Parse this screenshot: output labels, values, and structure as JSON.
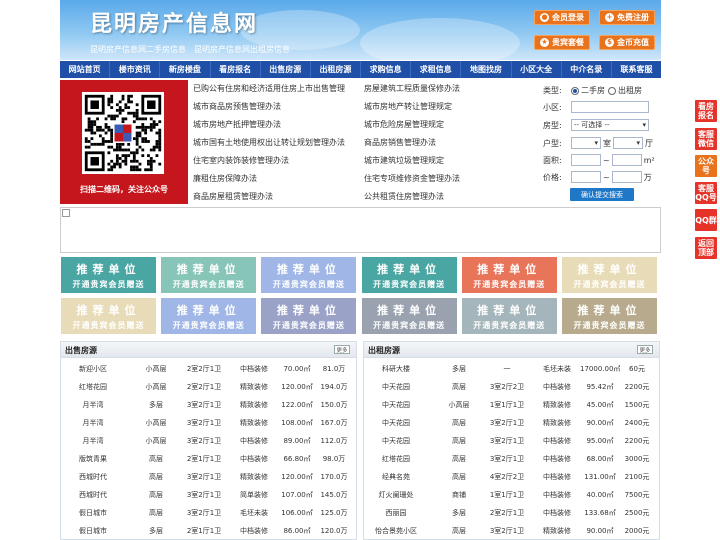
{
  "header": {
    "logo": "昆明房产信息网",
    "subtitle": "昆明房产信息网二手房信息　昆明房产信息网出租房信息",
    "buttons": [
      {
        "label": "会员登录",
        "icon": "user-icon"
      },
      {
        "label": "免费注册",
        "icon": "user-add-icon"
      },
      {
        "label": "贵宾套餐",
        "icon": "vip-icon"
      },
      {
        "label": "金币充值",
        "icon": "coin-icon"
      }
    ],
    "accent": "#e8731c"
  },
  "nav": [
    "网站首页",
    "楼市资讯",
    "新房楼盘",
    "看房报名",
    "出售房源",
    "出租房源",
    "求购信息",
    "求租信息",
    "地图找房",
    "小区大全",
    "中介名录",
    "联系客服"
  ],
  "qr": {
    "caption": "扫描二维码，关注公众号"
  },
  "links_left": [
    "已购公有住房和经济适用住房上市出售管理",
    "城市商品房预售管理办法",
    "城市房地产抵押管理办法",
    "城市国有土地使用权出让转让规划管理办法",
    "住宅室内装饰装修管理办法",
    "廉租住房保障办法",
    "商品房屋租赁管理办法"
  ],
  "links_right": [
    "房屋建筑工程质量保修办法",
    "城市房地产转让管理规定",
    "城市危险房屋管理规定",
    "商品房销售管理办法",
    "城市建筑垃圾管理规定",
    "住宅专项维修资金管理办法",
    "公共租赁住房管理办法"
  ],
  "search": {
    "type_label": "类型:",
    "opt_sale": "二手房",
    "opt_rent": "出租房",
    "community_label": "小区:",
    "housetype_label": "房型:",
    "housetype_value": "-- 可选择 --",
    "layout_label": "户型:",
    "room": "室",
    "hall": "厅",
    "area_label": "面积:",
    "area_unit": "m²",
    "price_label": "价格:",
    "price_unit": "万",
    "tilde": "~",
    "button": "确认提交搜索"
  },
  "recommend": {
    "title": "推荐单位",
    "sub": "开通贵宾会员赠送",
    "colors": [
      "#4aa6a3",
      "#87c5b8",
      "#9fb6e6",
      "#4aa6a3",
      "#e8745a",
      "#e8dcb8",
      "#e8dcb8",
      "#9fb6e6",
      "#9aa2c8",
      "#9aa2b0",
      "#a4b6bc",
      "#b8aa8c"
    ]
  },
  "sale": {
    "title": "出售房源",
    "more": "更多",
    "rows": [
      [
        "新迎小区",
        "小高层",
        "2室2厅1卫",
        "中档装修",
        "70.00㎡",
        "81.0万"
      ],
      [
        "红塔花园",
        "小高层",
        "2室2厅1卫",
        "精致装修",
        "120.00㎡",
        "194.0万"
      ],
      [
        "月半湾",
        "多层",
        "3室2厅1卫",
        "精致装修",
        "122.00㎡",
        "150.0万"
      ],
      [
        "月半湾",
        "小高层",
        "3室2厅1卫",
        "精致装修",
        "108.00㎡",
        "167.0万"
      ],
      [
        "月半湾",
        "小高层",
        "3室2厅1卫",
        "中档装修",
        "89.00㎡",
        "112.0万"
      ],
      [
        "版筑青果",
        "高层",
        "2室1厅1卫",
        "中档装修",
        "66.80㎡",
        "98.0万"
      ],
      [
        "西城时代",
        "高层",
        "3室2厅1卫",
        "精致装修",
        "120.00㎡",
        "170.0万"
      ],
      [
        "西城时代",
        "高层",
        "3室2厅1卫",
        "简单装修",
        "107.00㎡",
        "145.0万"
      ],
      [
        "假日城市",
        "高层",
        "3室2厅1卫",
        "毛坯未装",
        "106.00㎡",
        "125.0万"
      ],
      [
        "假日城市",
        "多层",
        "2室1厅1卫",
        "中档装修",
        "86.00㎡",
        "120.0万"
      ]
    ]
  },
  "rent": {
    "title": "出租房源",
    "more": "更多",
    "rows": [
      [
        "科研大楼",
        "多层",
        "一",
        "毛坯未装",
        "17000.00㎡",
        "60元"
      ],
      [
        "中天花园",
        "高层",
        "3室2厅2卫",
        "中档装修",
        "95.42㎡",
        "2200元"
      ],
      [
        "中天花园",
        "小高层",
        "1室1厅1卫",
        "精致装修",
        "45.00㎡",
        "1500元"
      ],
      [
        "中天花园",
        "高层",
        "3室2厅1卫",
        "精致装修",
        "90.00㎡",
        "2400元"
      ],
      [
        "中天花园",
        "高层",
        "3室2厅1卫",
        "中档装修",
        "95.00㎡",
        "2200元"
      ],
      [
        "红塔花园",
        "高层",
        "3室2厅1卫",
        "中档装修",
        "68.00㎡",
        "3000元"
      ],
      [
        "经典名苑",
        "高层",
        "4室2厅2卫",
        "中档装修",
        "131.00㎡",
        "2100元"
      ],
      [
        "灯火阑珊处",
        "商铺",
        "1室1厅1卫",
        "中档装修",
        "40.00㎡",
        "7500元"
      ],
      [
        "西丽园",
        "多层",
        "2室2厅1卫",
        "中档装修",
        "133.68㎡",
        "2500元"
      ],
      [
        "怡合景苑小区",
        "高层",
        "3室2厅1卫",
        "精致装修",
        "90.00㎡",
        "2000元"
      ]
    ]
  },
  "side": [
    "看房报名",
    "客服微信",
    "公众号",
    "客服QQ号",
    "QQ群",
    "返回顶部"
  ],
  "side_colors": [
    "#e6332a",
    "#e6332a",
    "#e8731c",
    "#e6332a",
    "#e6332a",
    "#e6332a"
  ]
}
